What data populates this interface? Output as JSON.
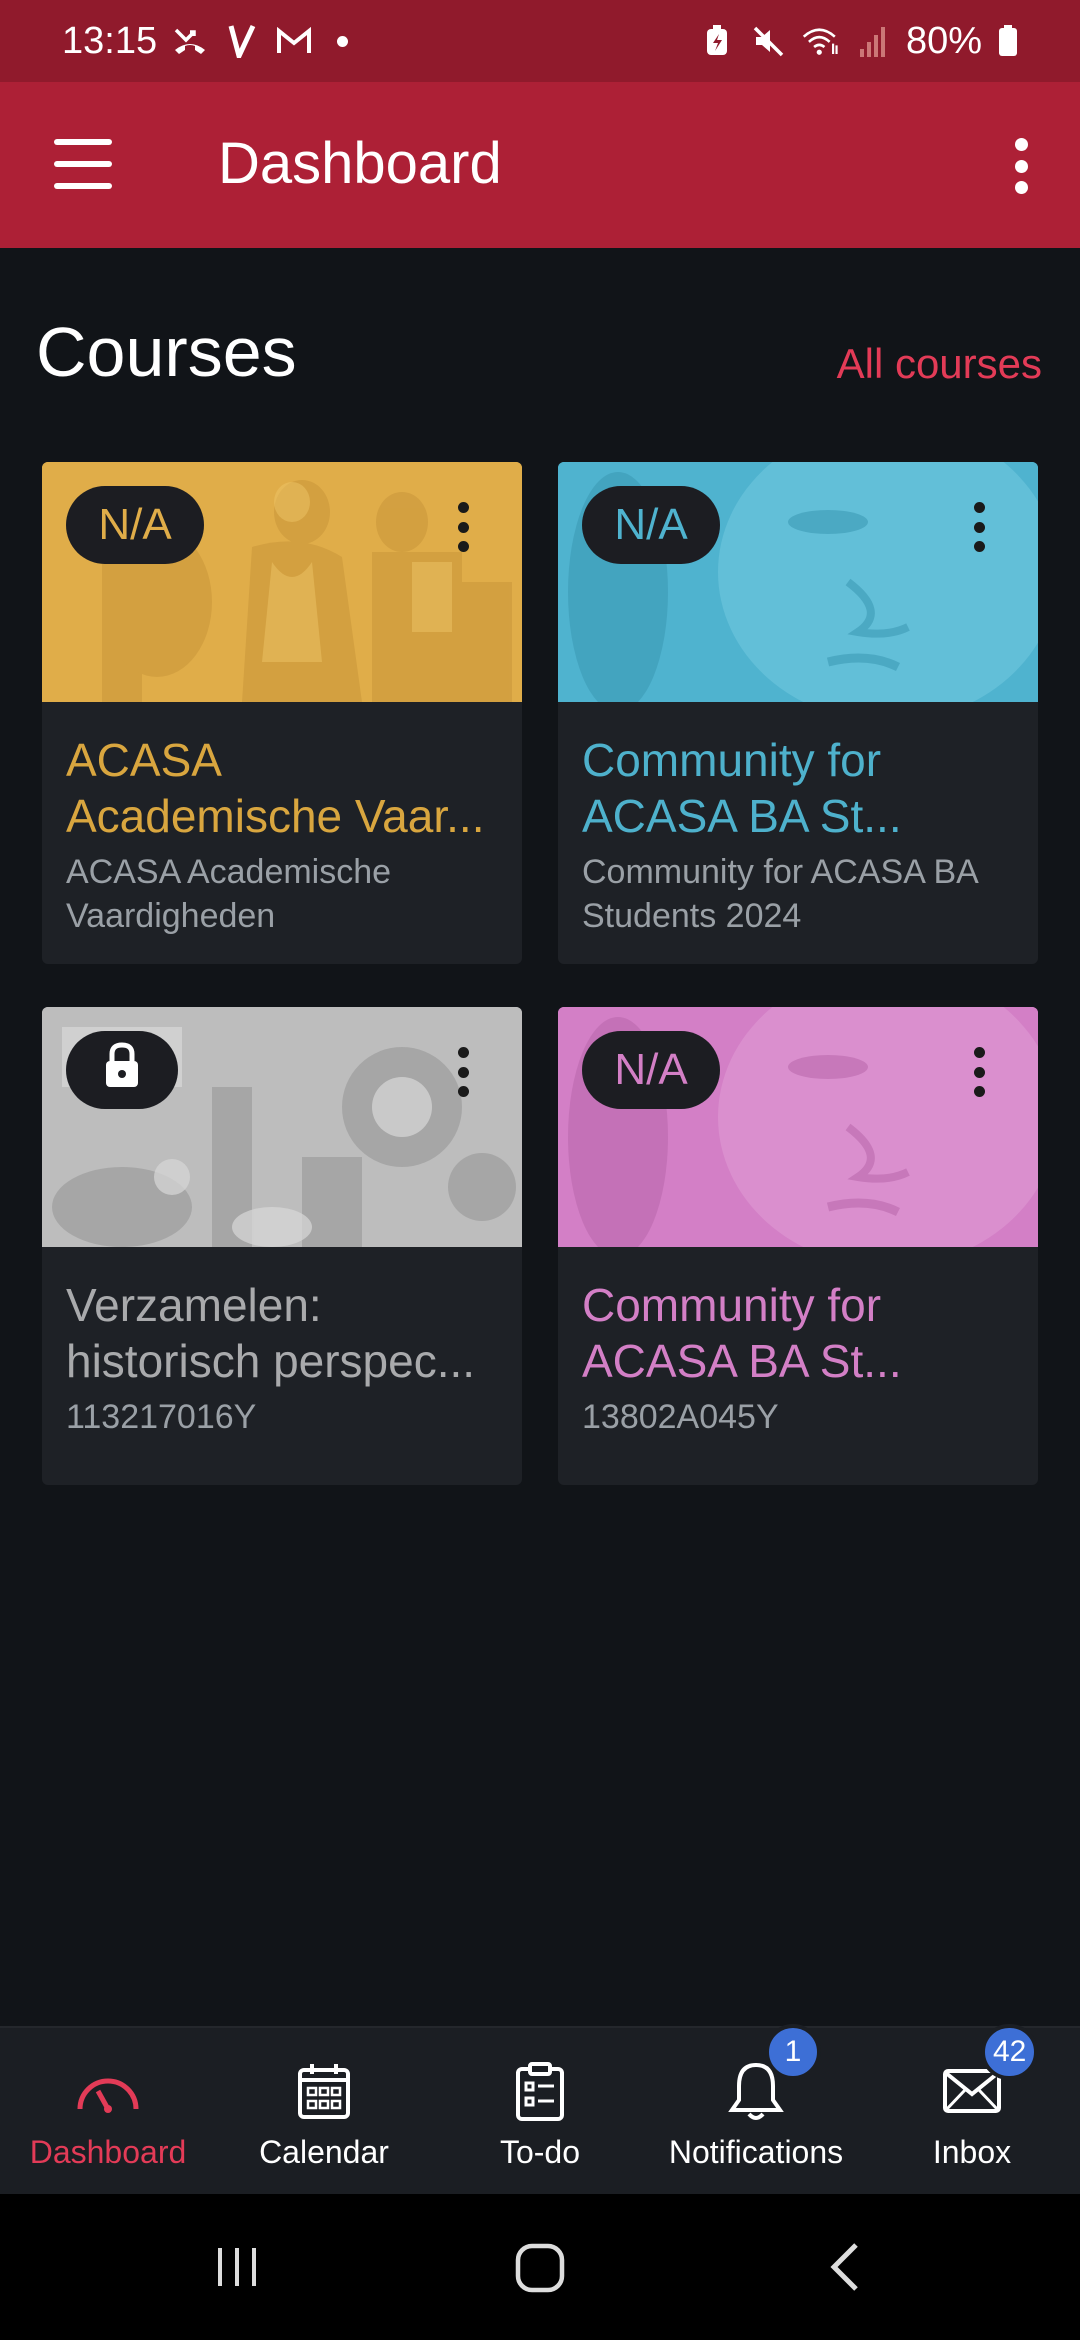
{
  "status_bar": {
    "time": "13:15",
    "battery": "80%",
    "icons_left": [
      "missed-call-icon",
      "v-app-icon",
      "gmail-icon"
    ],
    "icons_right": [
      "battery-saver-icon",
      "mute-icon",
      "wifi-icon",
      "signal-icon",
      "battery-icon"
    ]
  },
  "app_bar": {
    "title": "Dashboard",
    "color": "#ad2036"
  },
  "courses": {
    "heading": "Courses",
    "all_link": "All courses",
    "cards": [
      {
        "grade": "N/A",
        "title": "ACASA Academische Vaar...",
        "subtitle": "ACASA Academische Vaardigheden",
        "color": "#e0ad49",
        "title_color": "#d9a63f",
        "locked": false
      },
      {
        "grade": "N/A",
        "title": "Community for ACASA BA St...",
        "subtitle": "Community for ACASA BA Students 2024",
        "color": "#4fb3cf",
        "title_color": "#4eb1cc",
        "locked": false
      },
      {
        "grade": "",
        "title": "Verzamelen: historisch perspec...",
        "subtitle": "113217016Y",
        "color": "#bdbdbd",
        "title_color": "#a9aaac",
        "locked": true
      },
      {
        "grade": "N/A",
        "title": "Community for ACASA BA St...",
        "subtitle": "13802A045Y",
        "color": "#d37fc6",
        "title_color": "#d37fc6",
        "locked": false
      }
    ]
  },
  "bottom_nav": {
    "items": [
      {
        "label": "Dashboard",
        "icon": "dashboard-gauge-icon",
        "active": true
      },
      {
        "label": "Calendar",
        "icon": "calendar-icon",
        "active": false
      },
      {
        "label": "To-do",
        "icon": "clipboard-icon",
        "active": false
      },
      {
        "label": "Notifications",
        "icon": "bell-icon",
        "active": false,
        "badge": "1"
      },
      {
        "label": "Inbox",
        "icon": "envelope-icon",
        "active": false,
        "badge": "42"
      }
    ]
  },
  "system_nav": {
    "buttons": [
      "recent-apps-icon",
      "home-icon",
      "back-icon"
    ]
  }
}
